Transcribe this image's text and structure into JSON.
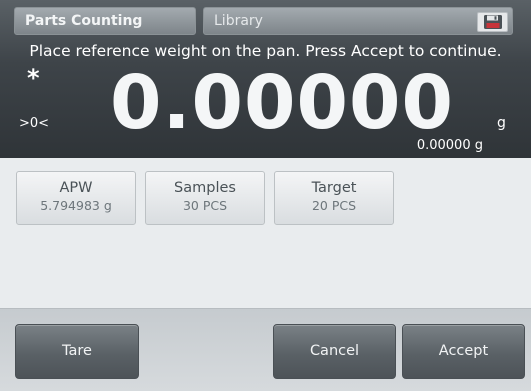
{
  "header": {
    "mode_label": "Parts Counting",
    "library_label": "Library",
    "save_icon": "floppy-disk-icon"
  },
  "display": {
    "prompt": "Place reference weight on the pan.  Press Accept to continue.",
    "stable_indicator": "*",
    "zero_indicator": ">0<",
    "weight": "0.00000",
    "unit": "g",
    "secondary_weight": "0.00000 g"
  },
  "info": {
    "apw": {
      "label": "APW",
      "value": "5.794983 g"
    },
    "samples": {
      "label": "Samples",
      "value": "30 PCS"
    },
    "target": {
      "label": "Target",
      "value": "20 PCS"
    }
  },
  "actions": {
    "tare": "Tare",
    "cancel": "Cancel",
    "accept": "Accept"
  },
  "colors": {
    "display_bg": "#3e4449",
    "screen_bg": "#e9ecee",
    "button_dark": "#5a6166"
  }
}
